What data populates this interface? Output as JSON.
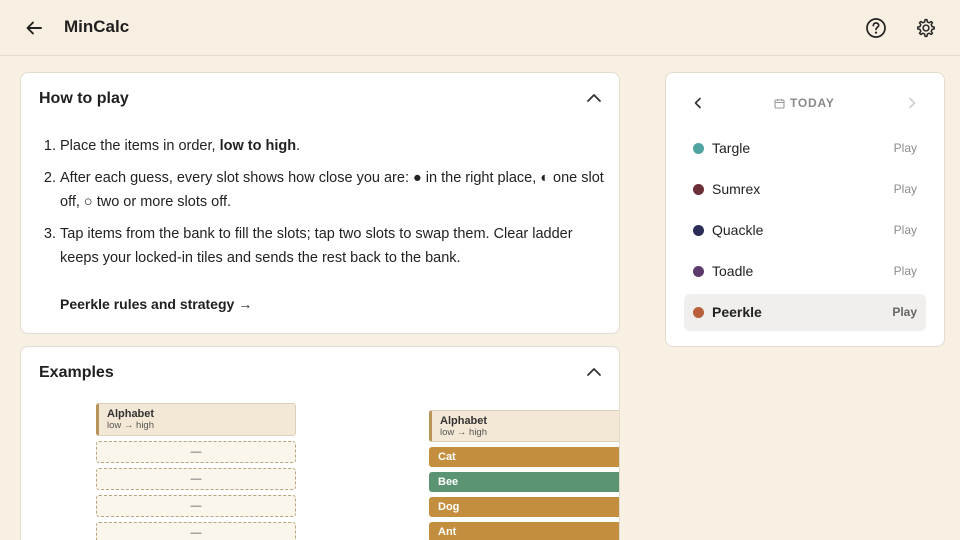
{
  "header": {
    "title": "MinCalc",
    "back_icon": "arrow-left-icon",
    "help_icon": "help-circle-icon",
    "settings_icon": "gear-icon"
  },
  "how_to_play": {
    "title": "How to play",
    "rules": [
      {
        "text": "Place the items in order, ",
        "bold": "low to high",
        "tail": "."
      },
      {
        "text": "After each guess, every slot shows how close you are: ● in the right place, ◐ one slot off, ○ two or more slots off."
      },
      {
        "text": "Tap items from the bank to fill the slots; tap two slots to swap them. Clear ladder keeps your locked-in tiles and sends the rest back to the bank."
      }
    ],
    "link": "Peerkle rules and strategy →"
  },
  "examples": {
    "title": "Examples",
    "left": {
      "header_title": "Alphabet",
      "header_sub": "low → high",
      "slots": [
        "—",
        "—",
        "—",
        "—"
      ]
    },
    "right": {
      "header_title": "Alphabet",
      "header_sub": "low → high",
      "tiles": [
        {
          "label": "Cat",
          "color": "#c38e3d",
          "mark": "partial"
        },
        {
          "label": "Bee",
          "color": "#5a9472",
          "mark": "full"
        },
        {
          "label": "Dog",
          "color": "#c38e3d",
          "mark": "partial"
        },
        {
          "label": "Ant",
          "color": "#c38e3d",
          "mark": "partial"
        }
      ]
    }
  },
  "sidebar": {
    "date_label": "TODAY",
    "games": [
      {
        "name": "Targle",
        "color": "#4fa3a0",
        "play": "Play"
      },
      {
        "name": "Sumrex",
        "color": "#6b2f38",
        "play": "Play"
      },
      {
        "name": "Quackle",
        "color": "#2a2d57",
        "play": "Play"
      },
      {
        "name": "Toadle",
        "color": "#5c3a6e",
        "play": "Play"
      },
      {
        "name": "Peerkle",
        "color": "#b9603c",
        "play": "Play",
        "active": true
      }
    ]
  },
  "colors": {
    "background": "#f8f0e3",
    "card": "#ffffff",
    "tile_gold": "#c38e3d",
    "tile_green": "#5a9472"
  }
}
